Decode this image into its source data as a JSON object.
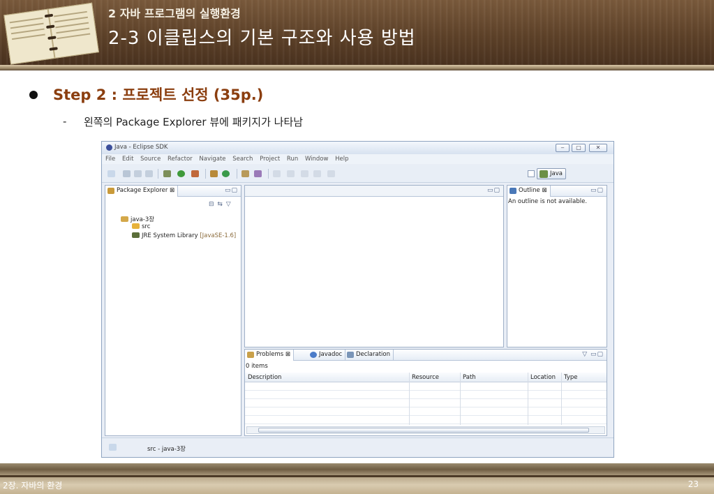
{
  "slide": {
    "subtitle": "2 자바 프로그램의 실행환경",
    "title": "2-3 이클립스의 기본 구조와 사용 방법",
    "step": "Step 2 : 프로젝트 선정 (35p.)",
    "dash": "-",
    "description": "왼쪽의 Package Explorer 뷰에 패키지가 나타남",
    "footer_left": "2장. 자바의 환경",
    "page_number": "23"
  },
  "eclipse": {
    "window_title": "Java - Eclipse SDK",
    "window_buttons": [
      "‒",
      "▢",
      "✕"
    ],
    "menu": [
      "File",
      "Edit",
      "Source",
      "Refactor",
      "Navigate",
      "Search",
      "Project",
      "Run",
      "Window",
      "Help"
    ],
    "perspective": "Java",
    "package_explorer": {
      "tab": "Package Explorer ⊠",
      "project": "java-3장",
      "src": "src",
      "jre": "JRE System Library",
      "jre_version": "[JavaSE-1.6]"
    },
    "outline": {
      "tab": "Outline ⊠",
      "message": "An outline is not available."
    },
    "bottom": {
      "tabs": [
        "Problems ⊠",
        "Javadoc",
        "Declaration"
      ],
      "count": "0 items",
      "columns": [
        "Description",
        "Resource",
        "Path",
        "Location",
        "Type"
      ]
    },
    "status_text": "src - java-3장",
    "colors": {
      "accent": "#8b3e0f",
      "header_wood": "#5e4229",
      "eclipse_frame": "#8ea4c0"
    }
  }
}
